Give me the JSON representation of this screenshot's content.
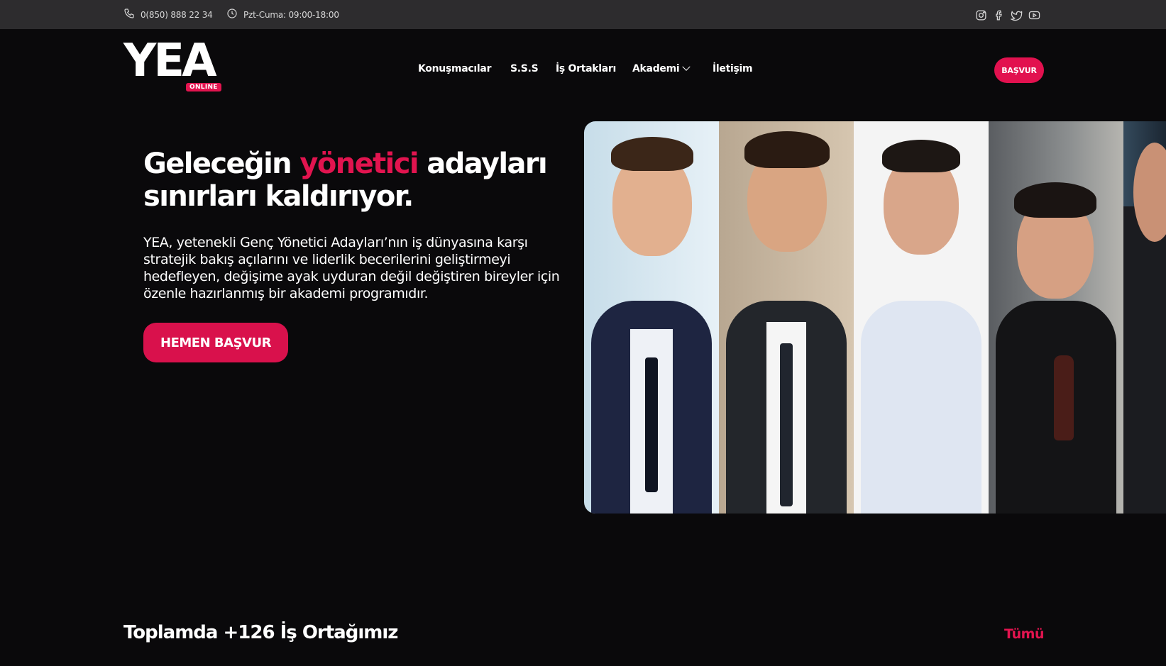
{
  "topbar": {
    "phone": "0(850) 888 22 34",
    "hours": "Pzt-Cuma: 09:00-18:00",
    "socials": [
      "instagram-icon",
      "facebook-icon",
      "twitter-icon",
      "youtube-icon"
    ]
  },
  "logo": {
    "text": "YEA",
    "badge": "ONLINE"
  },
  "nav": {
    "items": [
      "Konuşmacılar",
      "S.S.S",
      "İş Ortakları",
      "Akademi",
      "İletişim"
    ],
    "apply": "BAŞVUR"
  },
  "hero": {
    "title_pre": "Geleceğin ",
    "title_accent": "yönetici",
    "title_post": " adayları sınırları kaldırıyor.",
    "description": "YEA, yetenekli Genç Yönetici Adayları’nın iş dünyasına karşı stratejik bakış açılarını ve liderlik becerilerini geliştirmeyi hedefleyen, değişime ayak uyduran değil değiştiren bireyler için özenle hazırlanmış bir akademi programıdır.",
    "cta": "HEMEN BAŞVUR"
  },
  "partners": {
    "title": "Toplamda +126 İş Ortağımız",
    "all_link": "Tümü"
  },
  "colors": {
    "accent": "#e2144f",
    "background": "#0a090b",
    "topbar": "#2d2c2e"
  }
}
